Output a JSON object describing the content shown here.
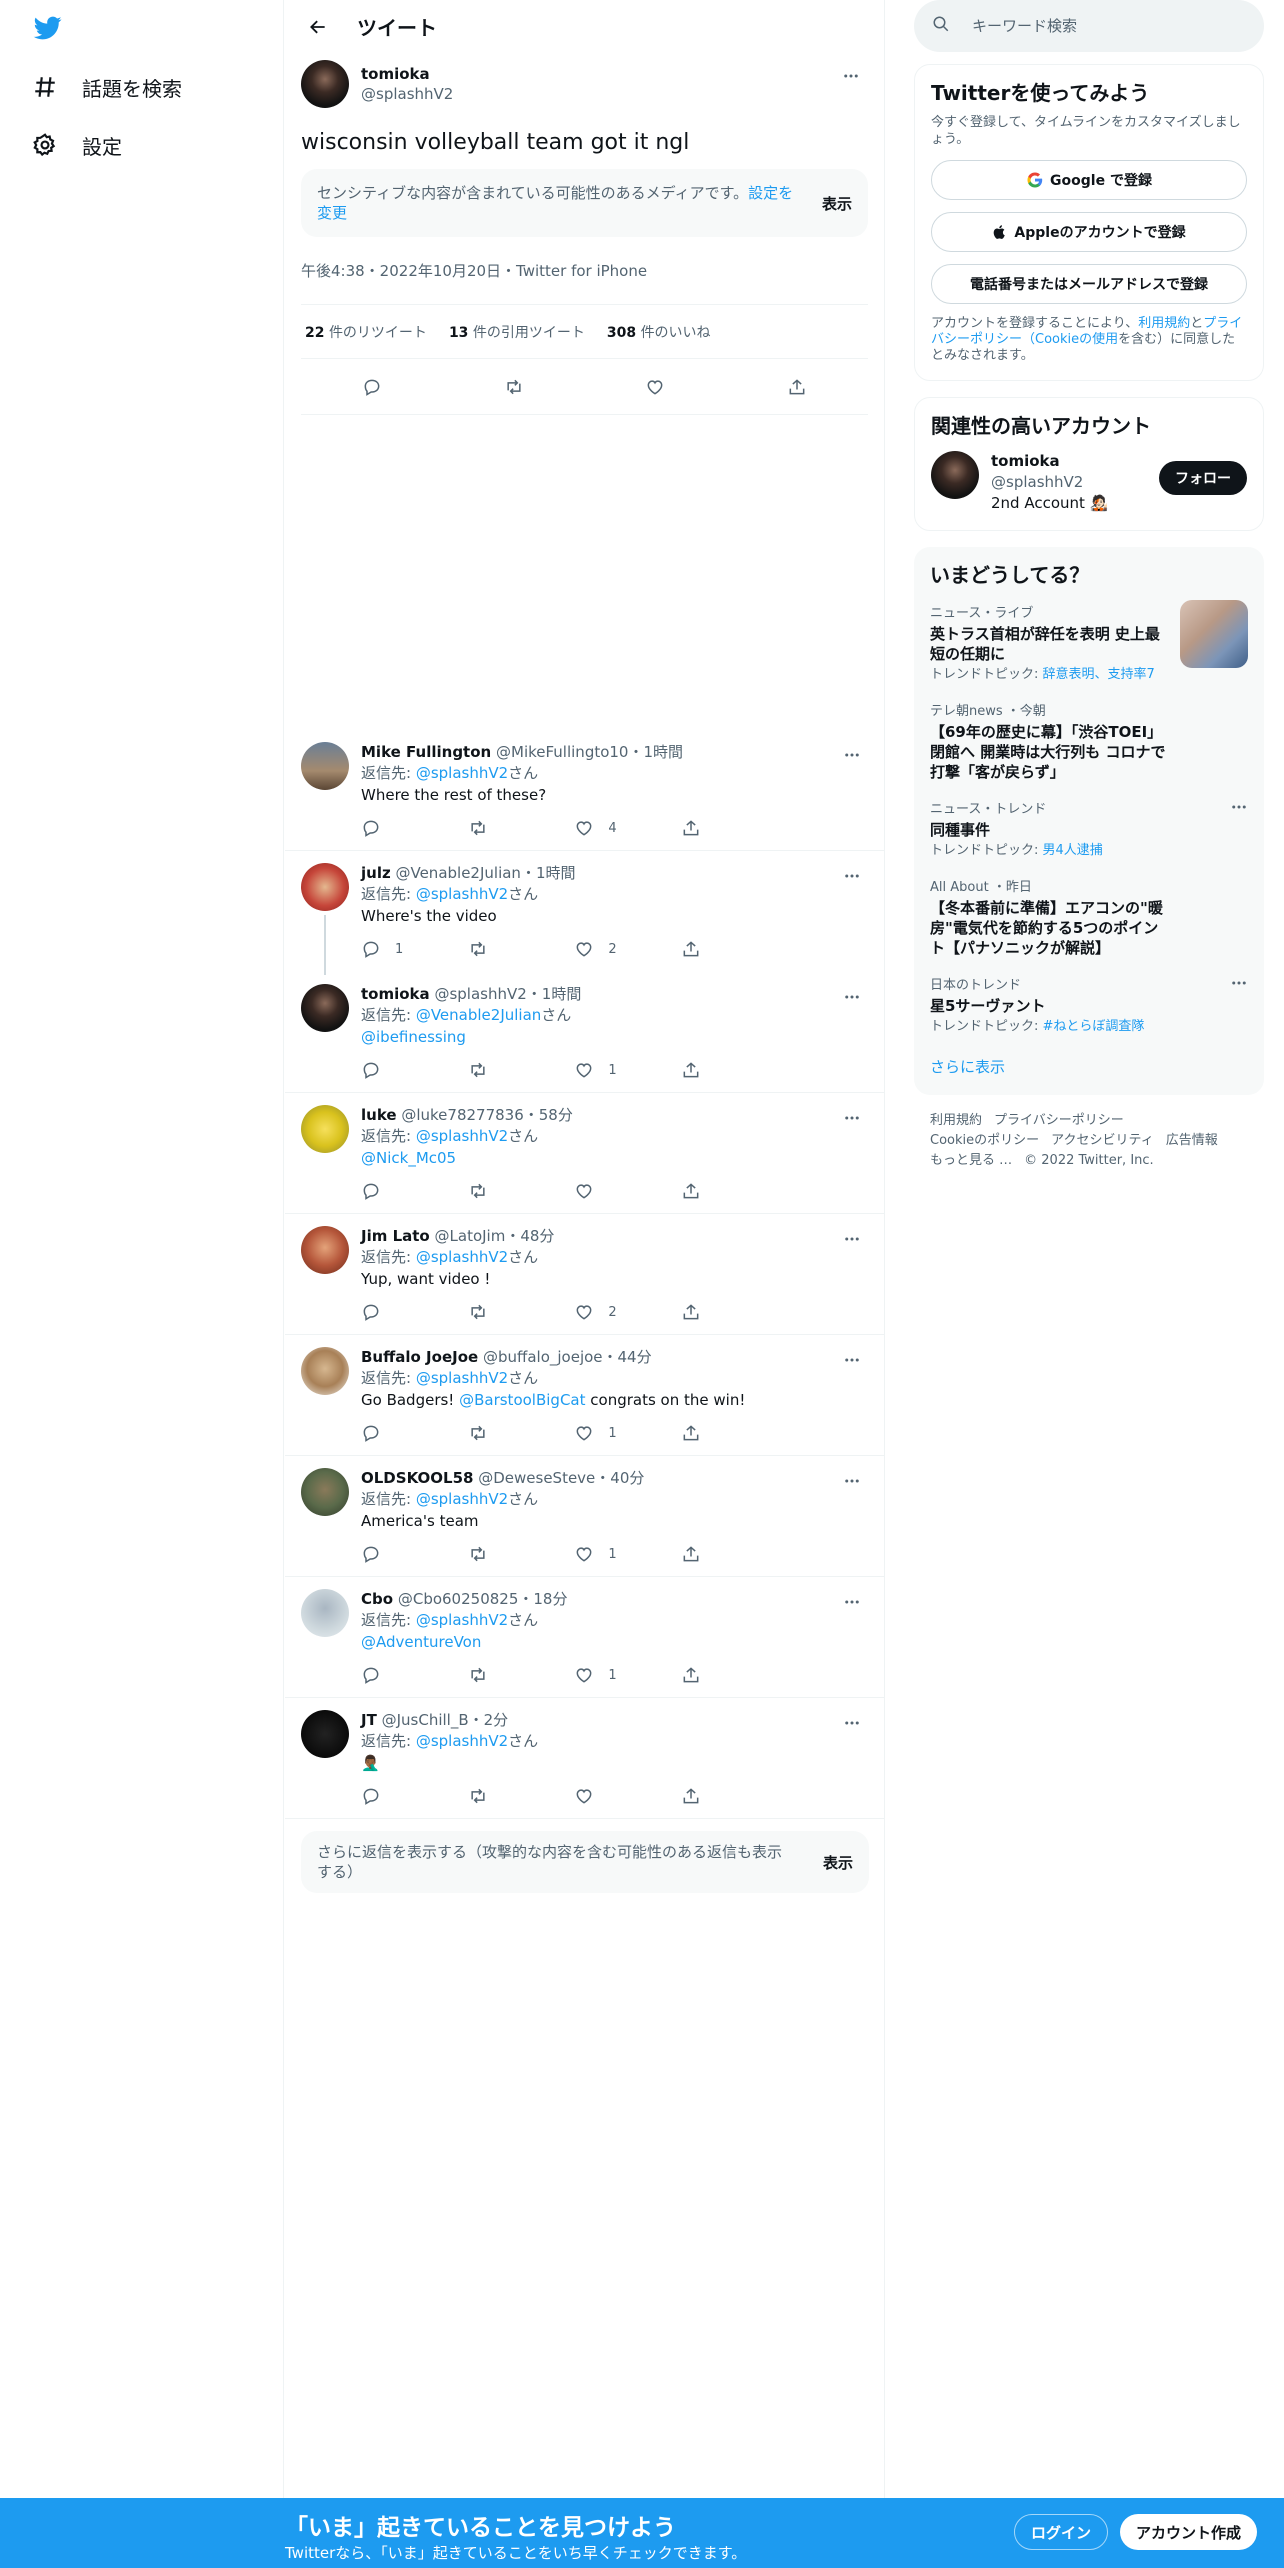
{
  "nav": {
    "items": [
      {
        "label": "話題を検索",
        "icon": "hashtag-icon"
      },
      {
        "label": "設定",
        "icon": "gear-icon"
      }
    ]
  },
  "header": {
    "title": "ツイート"
  },
  "tweet": {
    "name": "tomioka",
    "handle": "@splashhV2",
    "text": "wisconsin volleyball team got it ngl",
    "sensitive_msg": "センシティブな内容が含まれている可能性のあるメディアです。",
    "sensitive_link": "設定を変更",
    "show_label": "表示",
    "meta": "午後4:38・2022年10月20日・Twitter for iPhone",
    "stats": [
      {
        "num": "22",
        "label": "件のリツイート"
      },
      {
        "num": "13",
        "label": "件の引用ツイート"
      },
      {
        "num": "308",
        "label": "件のいいね"
      }
    ]
  },
  "replies": [
    {
      "name": "Mike Fullington",
      "handle": "@MikeFullingto10",
      "time": "・1時間",
      "reply_to_prefix": "返信先: ",
      "reply_to": "@splashhV2",
      "reply_to_suffix": "さん",
      "text": "Where the rest of these?",
      "mention": "",
      "tail": "",
      "reply_count": "",
      "like_count": "4"
    },
    {
      "name": "julz",
      "handle": "@Venable2Julian",
      "time": "・1時間",
      "reply_to_prefix": "返信先: ",
      "reply_to": "@splashhV2",
      "reply_to_suffix": "さん",
      "text": "Where's the video",
      "mention": "",
      "tail": "",
      "reply_count": "1",
      "like_count": "2"
    },
    {
      "name": "tomioka",
      "handle": "@splashhV2",
      "time": "・1時間",
      "reply_to_prefix": "返信先: ",
      "reply_to": "@Venable2Julian",
      "reply_to_suffix": "さん",
      "text": "",
      "mention": "@ibefinessing",
      "tail": "",
      "reply_count": "",
      "like_count": "1"
    },
    {
      "name": "luke",
      "handle": "@luke78277836",
      "time": "・58分",
      "reply_to_prefix": "返信先: ",
      "reply_to": "@splashhV2",
      "reply_to_suffix": "さん",
      "text": "",
      "mention": "@Nick_Mc05",
      "tail": "",
      "reply_count": "",
      "like_count": ""
    },
    {
      "name": "Jim Lato",
      "handle": "@LatoJim",
      "time": "・48分",
      "reply_to_prefix": "返信先: ",
      "reply_to": "@splashhV2",
      "reply_to_suffix": "さん",
      "text": "Yup, want video !",
      "mention": "",
      "tail": "",
      "reply_count": "",
      "like_count": "2"
    },
    {
      "name": "Buffalo JoeJoe",
      "handle": "@buffalo_joejoe",
      "time": "・44分",
      "reply_to_prefix": "返信先: ",
      "reply_to": "@splashhV2",
      "reply_to_suffix": "さん",
      "text": "Go Badgers! ",
      "mention": "@BarstoolBigCat",
      "tail": " congrats on the win!",
      "reply_count": "",
      "like_count": "1"
    },
    {
      "name": "OLDSKOOL58",
      "handle": "@DeweseSteve",
      "time": "・40分",
      "reply_to_prefix": "返信先: ",
      "reply_to": "@splashhV2",
      "reply_to_suffix": "さん",
      "text": "America's team",
      "mention": "",
      "tail": "",
      "reply_count": "",
      "like_count": "1"
    },
    {
      "name": "Cbo",
      "handle": "@Cbo60250825",
      "time": "・18分",
      "reply_to_prefix": "返信先: ",
      "reply_to": "@splashhV2",
      "reply_to_suffix": "さん",
      "text": "",
      "mention": "@AdventureVon",
      "tail": "",
      "reply_count": "",
      "like_count": "1"
    },
    {
      "name": "JT",
      "handle": "@JusChill_B",
      "time": "・2分",
      "reply_to_prefix": "返信先: ",
      "reply_to": "@splashhV2",
      "reply_to_suffix": "さん",
      "text": "🤦🏾‍♂️",
      "mention": "",
      "tail": "",
      "reply_count": "",
      "like_count": ""
    }
  ],
  "more_replies": {
    "msg": "さらに返信を表示する（攻撃的な内容を含む可能性のある返信も表示する）",
    "label": "表示"
  },
  "search": {
    "placeholder": "キーワード検索"
  },
  "signup": {
    "title": "Twitterを使ってみよう",
    "sub": "今すぐ登録して、タイムラインをカスタマイズしましょう。",
    "google": "Google で登録",
    "apple": "Appleのアカウントで登録",
    "phone": "電話番号またはメールアドレスで登録",
    "terms_prefix": "アカウントを登録することにより、",
    "terms_link1": "利用規約",
    "terms_mid": "と",
    "terms_link2": "プライバシーポリシー（Cookieの使用",
    "terms_suffix": "を含む）に同意したとみなされます。"
  },
  "relevant": {
    "title": "関連性の高いアカウント",
    "name": "tomioka",
    "handle": "@splashhV2",
    "bio": "2nd Account 🧑🏻‍🎤",
    "follow": "フォロー"
  },
  "trends": {
    "title": "いまどうしてる？",
    "items": [
      {
        "context": "ニュース・ライブ",
        "title": "英トラス首相が辞任を表明 史上最短の任期に",
        "topic_prefix": "トレンドトピック: ",
        "topic": "辞意表明、支持率7"
      },
      {
        "context": "テレ朝news ・今朝",
        "title": "【69年の歴史に幕】「渋谷TOEI」閉館へ 開業時は大行列も コロナで打撃「客が戻らず」",
        "topic_prefix": "",
        "topic": ""
      },
      {
        "context": "ニュース・トレンド",
        "title": "同種事件",
        "topic_prefix": "トレンドトピック: ",
        "topic": "男4人逮捕"
      },
      {
        "context": "All About ・昨日",
        "title": "【冬本番前に準備】エアコンの\"暖房\"電気代を節約する5つのポイント【パナソニックが解説】",
        "topic_prefix": "",
        "topic": ""
      },
      {
        "context": "日本のトレンド",
        "title": "星5サーヴァント",
        "topic_prefix": "トレンドトピック: ",
        "topic": "#ねとらぼ調査隊"
      }
    ],
    "show_more": "さらに表示"
  },
  "footer": {
    "links": [
      "利用規約",
      "プライバシーポリシー",
      "Cookieのポリシー",
      "アクセシビリティ",
      "広告情報",
      "もっと見る …"
    ],
    "copyright": "© 2022 Twitter, Inc."
  },
  "bottombar": {
    "title": "「いま」起きていることを見つけよう",
    "sub": "Twitterなら、「いま」起きていることをいち早くチェックできます。",
    "login": "ログイン",
    "signup": "アカウント作成"
  }
}
